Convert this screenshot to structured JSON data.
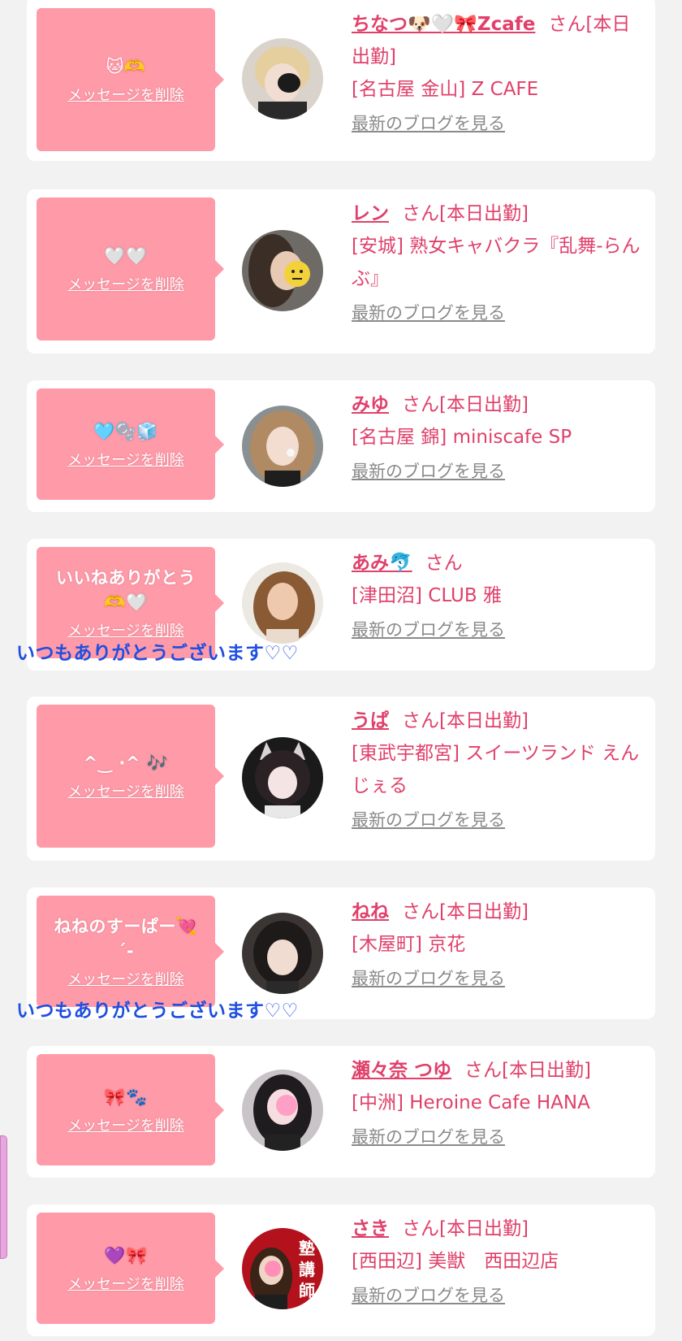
{
  "colors": {
    "accent": "#e0406a",
    "message_bg": "#ff9aa8",
    "link_gray": "#8a8a8a",
    "overlay_blue": "#1f4fe0"
  },
  "delete_label": "メッセージを削除",
  "blog_label": "最新のブログを見る",
  "cards": [
    {
      "message": "🐱🫶",
      "name": "ちなつ🐶🤍🎀Zcafe",
      "suffix": "さん[本日出勤]",
      "shop": "[名古屋 金山] Z CAFE"
    },
    {
      "message": "🤍🤍",
      "name": "レン",
      "suffix": "さん[本日出勤]",
      "shop": "[安城] 熟女キャバクラ『乱舞-らんぶ』"
    },
    {
      "message": "🩵🫧🧊",
      "name": "みゆ",
      "suffix": "さん[本日出勤]",
      "shop": "[名古屋 錦] miniscafe SP"
    },
    {
      "message": "いいねありがとう\n🫶🤍",
      "name": "あみ🐬",
      "suffix": "さん",
      "shop": "[津田沼] CLUB 雅"
    },
    {
      "message": "^‿ ·^ 🎶",
      "name": "うぱ",
      "suffix": "さん[本日出勤]",
      "shop": "[東武宇都宮] スイーツランド えんじぇる"
    },
    {
      "message": "ねねのすーぱー💘\n´-",
      "name": "ねね",
      "suffix": "さん[本日出勤]",
      "shop": "[木屋町] 京花"
    },
    {
      "message": "🎀🐾",
      "name": "瀬々奈 つゆ",
      "suffix": "さん[本日出勤]",
      "shop": "[中洲] Heroine Cafe HANA"
    },
    {
      "message": "💜🎀",
      "name": "さき",
      "suffix": "さん[本日出勤]",
      "shop": "[西田辺] 美獣　西田辺店"
    }
  ],
  "overlays": [
    "いつもありがとうございます♡♡",
    "いつもありがとうございます♡♡"
  ],
  "avatar_sign_text": "塾講師"
}
